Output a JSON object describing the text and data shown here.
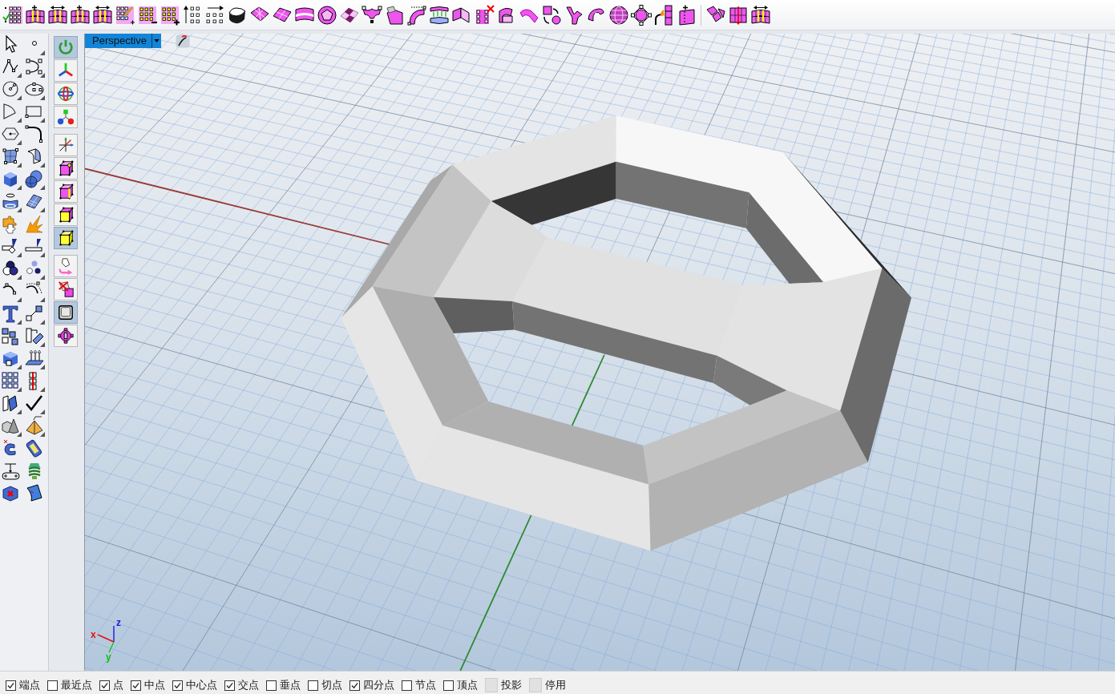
{
  "side_toolbar": {
    "groups": [
      {
        "buttons": [
          {
            "selected": true
          },
          {
            "selected": false
          },
          {
            "selected": false
          },
          {
            "selected": false
          }
        ]
      },
      {
        "buttons": [
          {
            "selected": false
          },
          {
            "selected": false
          },
          {
            "selected": false
          },
          {
            "selected": false
          },
          {
            "selected": true
          }
        ]
      },
      {
        "buttons": [
          {
            "selected": false
          },
          {
            "selected": false
          },
          {
            "selected": true
          },
          {
            "selected": false
          }
        ]
      }
    ]
  },
  "viewport": {
    "title": "Perspective",
    "axis_labels": [
      "z",
      "x",
      "y"
    ]
  },
  "status_bar": {
    "osnaps": [
      {
        "kind": "checkbox",
        "label": "端点",
        "checked": true
      },
      {
        "kind": "checkbox",
        "label": "最近点",
        "checked": false
      },
      {
        "kind": "checkbox",
        "label": "点",
        "checked": true
      },
      {
        "kind": "checkbox",
        "label": "中点",
        "checked": true
      },
      {
        "kind": "checkbox",
        "label": "中心点",
        "checked": true
      },
      {
        "kind": "checkbox",
        "label": "交点",
        "checked": true
      },
      {
        "kind": "checkbox",
        "label": "垂点",
        "checked": false
      },
      {
        "kind": "checkbox",
        "label": "切点",
        "checked": false
      },
      {
        "kind": "checkbox",
        "label": "四分点",
        "checked": true
      },
      {
        "kind": "checkbox",
        "label": "节点",
        "checked": false
      },
      {
        "kind": "checkbox",
        "label": "顶点",
        "checked": false
      },
      {
        "kind": "toggle",
        "label": "投影",
        "checked": false
      },
      {
        "kind": "toggle",
        "label": "停用",
        "checked": false
      }
    ]
  }
}
